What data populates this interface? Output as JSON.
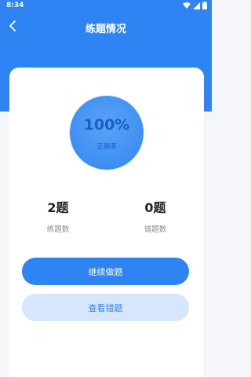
{
  "status_bar": {
    "time": "8:34"
  },
  "header": {
    "title": "练题情况",
    "back_icon": "chevron-left-icon"
  },
  "summary": {
    "accuracy_value": "100%",
    "accuracy_label": "正确率",
    "practiced_value": "2题",
    "practiced_label": "练题数",
    "wrong_value": "0题",
    "wrong_label": "错题数"
  },
  "actions": {
    "continue_label": "继续做题",
    "review_wrong_label": "查看错题"
  },
  "colors": {
    "accent": "#2e84f2",
    "secondary_button_bg": "#d6e6fc"
  }
}
